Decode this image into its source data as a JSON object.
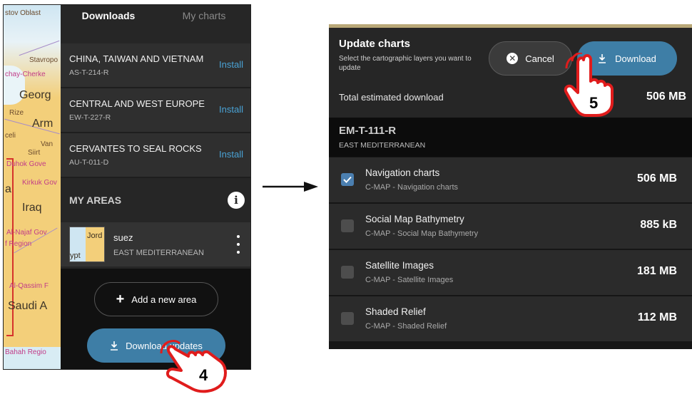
{
  "left_screen": {
    "map_labels": [
      "stov Oblast",
      "Stavropo",
      "chay-Cherke",
      "Georg",
      "Rize",
      "Arm",
      "celi",
      "Van",
      "Siirt",
      "Duhok Gove",
      "Kirkuk Gov",
      "a",
      "Iraq",
      "Al-Najaf Gov",
      "f Region",
      "Al-Qassim F",
      "Saudi A",
      "Bahah Regio"
    ],
    "tabs": {
      "downloads": "Downloads",
      "my_charts": "My charts"
    },
    "downloads": [
      {
        "name": "CHINA, TAIWAN AND VIETNAM",
        "code": "AS-T-214-R",
        "action": "Install"
      },
      {
        "name": "CENTRAL AND WEST EUROPE",
        "code": "EW-T-227-R",
        "action": "Install"
      },
      {
        "name": "CERVANTES TO SEAL ROCKS",
        "code": "AU-T-011-D",
        "action": "Install"
      }
    ],
    "my_areas_title": "MY AREAS",
    "info_glyph": "i",
    "area": {
      "name": "suez",
      "region": "EAST MEDITERRANEAN",
      "thumb_labels": [
        "Jord",
        "ypt"
      ]
    },
    "add_area_label": "Add a new area",
    "download_updates_label": "Download updates",
    "callout_number": "4"
  },
  "right_screen": {
    "title": "Update charts",
    "subtitle": "Select the cartographic layers you want to update",
    "cancel_label": "Cancel",
    "download_label": "Download",
    "total_label": "Total estimated download",
    "total_value": "506 MB",
    "pack": {
      "code": "EM-T-111-R",
      "region": "EAST MEDITERRANEAN"
    },
    "layers": [
      {
        "name": "Navigation charts",
        "source": "C-MAP - Navigation charts",
        "size": "506 MB",
        "checked": true
      },
      {
        "name": "Social Map Bathymetry",
        "source": "C-MAP - Social Map Bathymetry",
        "size": "885 kB",
        "checked": false
      },
      {
        "name": "Satellite Images",
        "source": "C-MAP - Satellite Images",
        "size": "181 MB",
        "checked": false
      },
      {
        "name": "Shaded Relief",
        "source": "C-MAP - Shaded Relief",
        "size": "112 MB",
        "checked": false
      }
    ],
    "callout_number": "5"
  },
  "colors": {
    "accent_blue": "#3e7ea6",
    "link_blue": "#4aa3d6",
    "map_land": "#f3cf7a",
    "map_border": "#d6322c",
    "callout_red": "#e01c1c"
  },
  "icons": [
    "info-icon",
    "kebab-icon",
    "plus-icon",
    "download-icon",
    "cancel-icon",
    "checkmark-icon",
    "pointing-hand-icon",
    "arrow-right-icon"
  ]
}
